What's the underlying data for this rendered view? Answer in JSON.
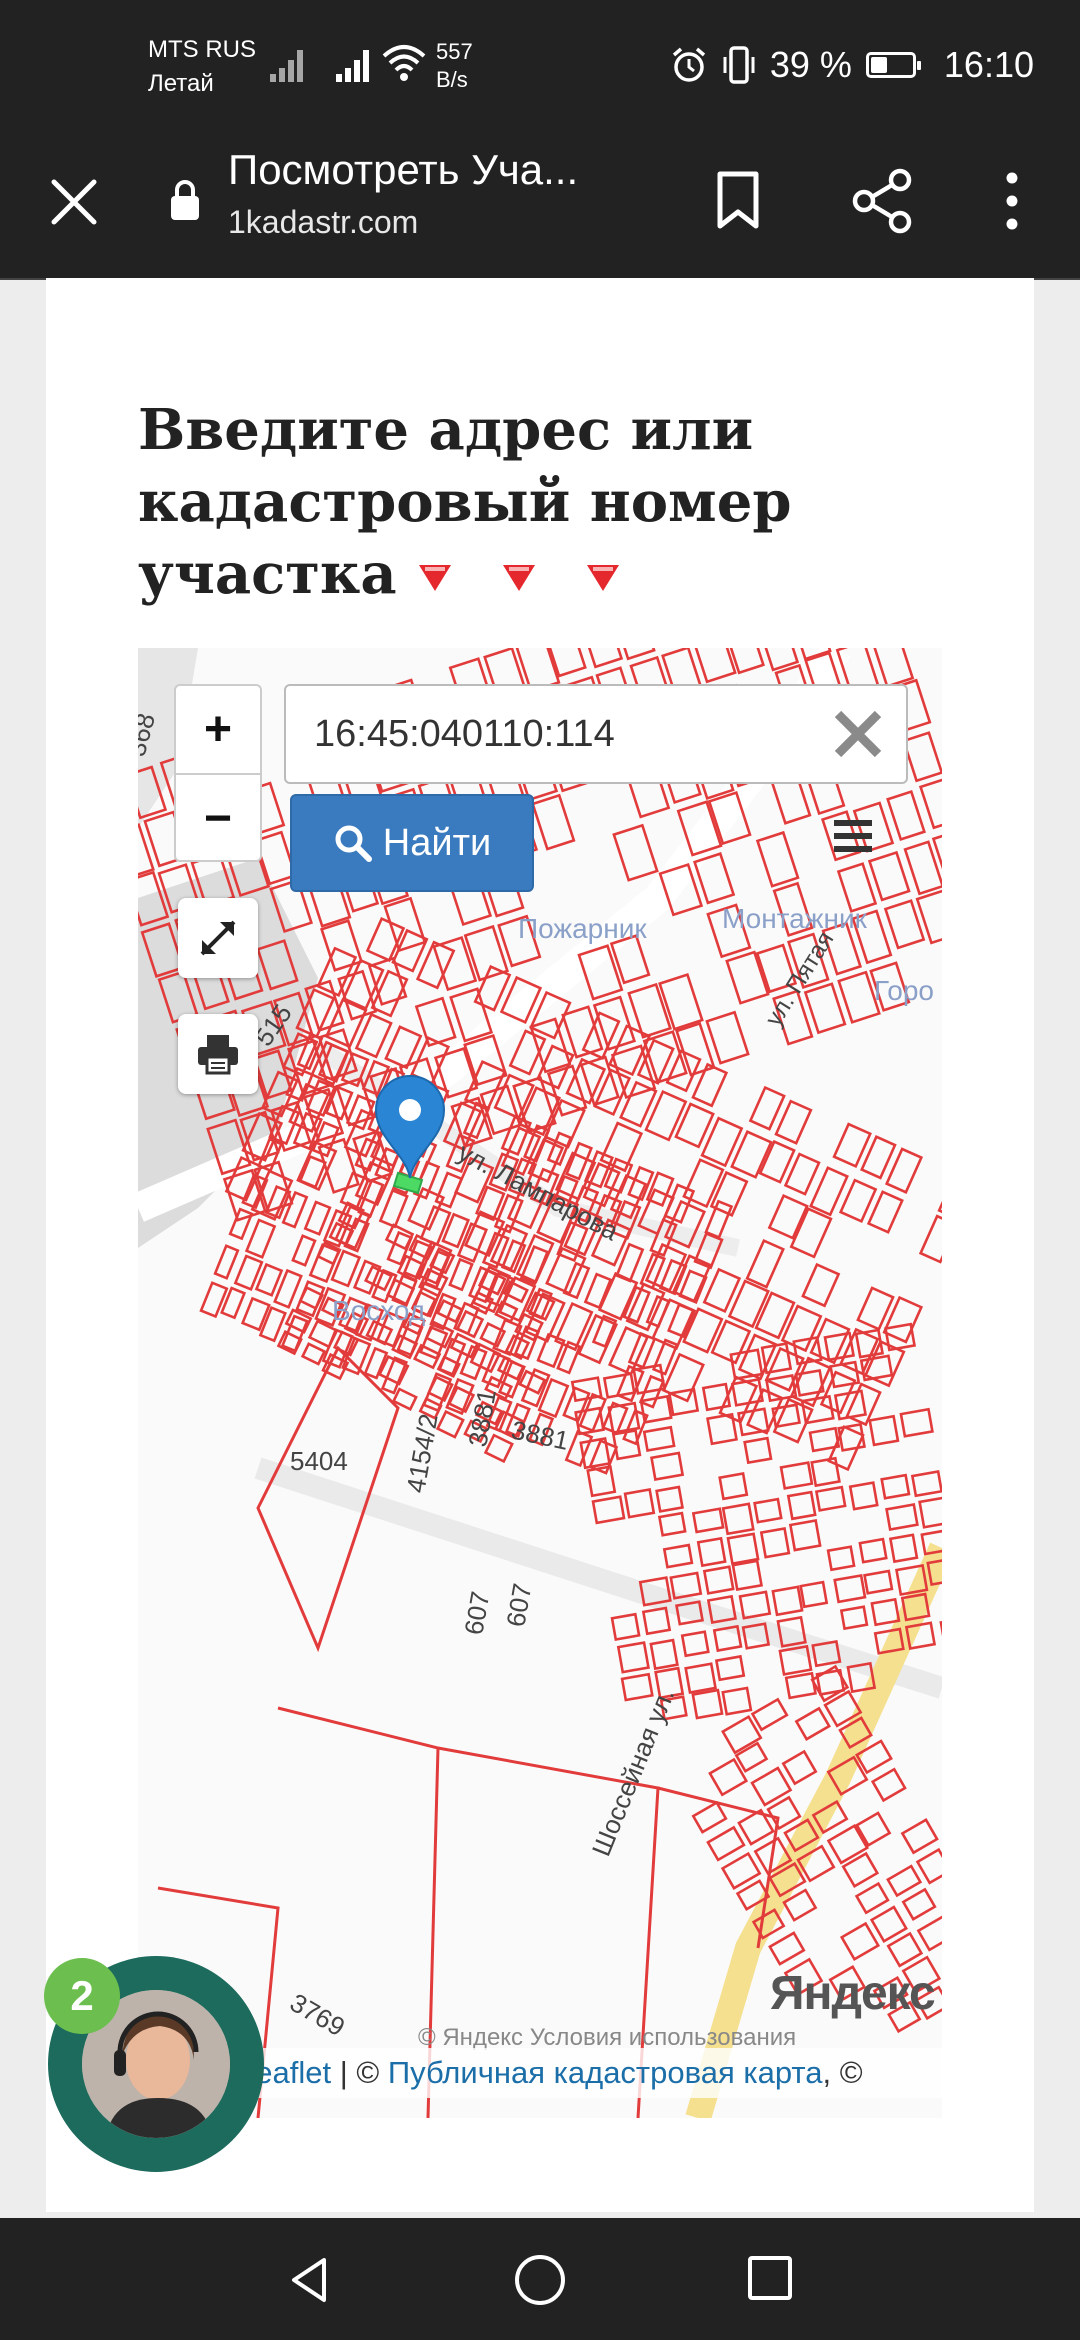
{
  "status_bar": {
    "operator_line1": "MTS RUS",
    "operator_line2": "Летай",
    "speed_value": "557",
    "speed_unit": "B/s",
    "battery_percent": "39 %",
    "battery_level": 0.39,
    "time": "16:10",
    "icons": [
      "signal-icon",
      "wifi-icon",
      "alarm-icon",
      "vibrate-icon",
      "battery-icon"
    ]
  },
  "browser": {
    "page_title": "Посмотреть Уча...",
    "url": "1kadastr.com",
    "icons": [
      "close-icon",
      "lock-icon",
      "bookmark-icon",
      "share-icon",
      "more-icon"
    ]
  },
  "page": {
    "heading": "Введите адрес или кадастровый номер участка"
  },
  "map": {
    "zoom_in": "+",
    "zoom_out": "−",
    "search_value": "16:45:040110:114",
    "find_button": "Найти",
    "labels": {
      "street_lamparova": "ул. Лампарова",
      "street_shosseynaya": "Шоссейная ул.",
      "street_pyatyi": "ул. Пятая",
      "district_pozharnik": "Пожарник",
      "district_montazhnik": "Монтажник",
      "district_voskhod": "Восход",
      "district_gor": "Горо",
      "n368": "368",
      "n515": "515",
      "n5404": "5404",
      "n4154": "4154/2",
      "n3881a": "3881",
      "n3881b": "3881",
      "n607a": "607",
      "n607b": "607",
      "n3769": "3769"
    },
    "yandex_logo": "Яндекс",
    "attribution_overlay": "© Яндекс  Условия использования",
    "attribution": {
      "leaflet": "Leaflet",
      "sep1": " | © ",
      "pkk": "Публичная кадастровая карта",
      "sep2": ", ©"
    },
    "colors": {
      "parcel_lines": "#e23b3b",
      "road": "#f5e6a3",
      "find_button": "#3a7bbf",
      "marker": "#2a86d4",
      "selected_parcel": "#4cd964"
    }
  },
  "chat_widget": {
    "badge_count": "2"
  },
  "nav_bar": {
    "icons": [
      "back-icon",
      "home-icon",
      "recents-icon"
    ]
  }
}
